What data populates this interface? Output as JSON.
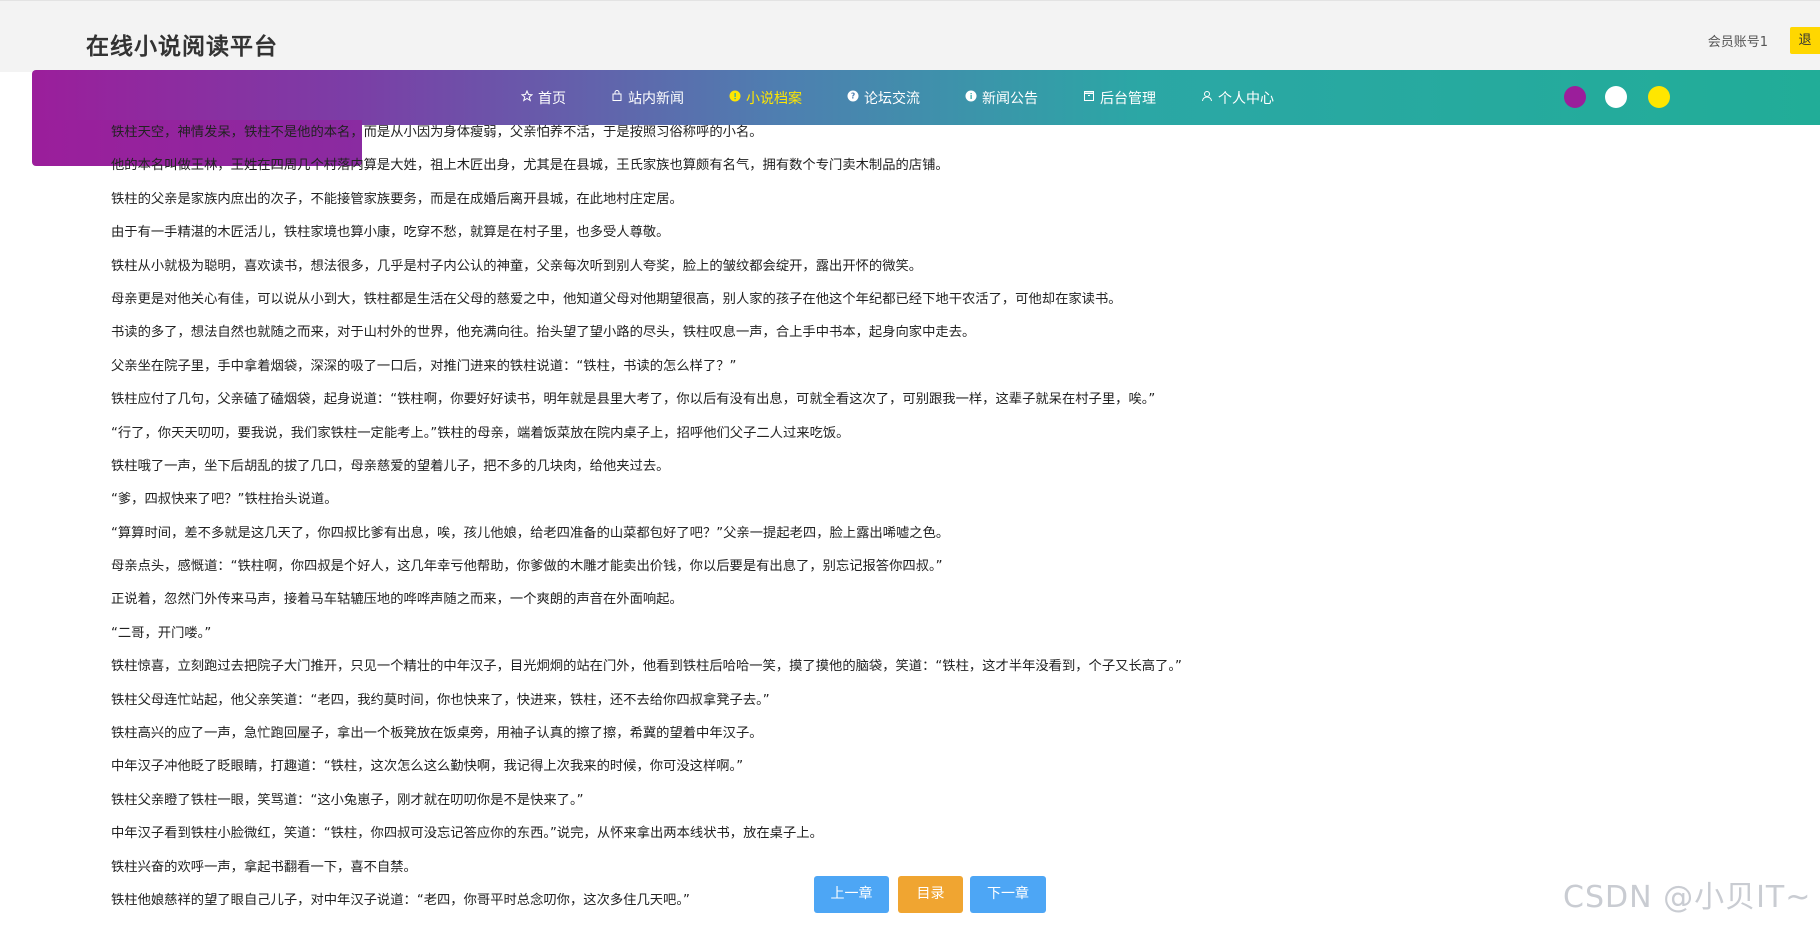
{
  "site": {
    "title": "在线小说阅读平台",
    "account_label": "会员账号1",
    "yellow_button_label": "退"
  },
  "nav": {
    "items": [
      {
        "label": "首页",
        "icon": "star-icon"
      },
      {
        "label": "站内新闻",
        "icon": "bag-icon"
      },
      {
        "label": "小说档案",
        "icon": "info-circle-icon",
        "active": true
      },
      {
        "label": "论坛交流",
        "icon": "question-circle-icon"
      },
      {
        "label": "新闻公告",
        "icon": "info-circle-icon"
      },
      {
        "label": "后台管理",
        "icon": "box-icon"
      },
      {
        "label": "个人中心",
        "icon": "user-icon"
      }
    ],
    "theme_dots": [
      "#9b1e9b",
      "#ffffff",
      "#ffe600"
    ]
  },
  "article": {
    "paragraphs": [
      "铁柱天空，神情发呆，铁柱不是他的本名，而是从小因为身体瘦弱，父亲怕养不活，于是按照习俗称呼的小名。",
      "他的本名叫做王林，王姓在四周几个村落内算是大姓，祖上木匠出身，尤其是在县城，王氏家族也算颇有名气，拥有数个专门卖木制品的店铺。",
      "铁柱的父亲是家族内庶出的次子，不能接管家族要务，而是在成婚后离开县城，在此地村庄定居。",
      "由于有一手精湛的木匠活儿，铁柱家境也算小康，吃穿不愁，就算是在村子里，也多受人尊敬。",
      "铁柱从小就极为聪明，喜欢读书，想法很多，几乎是村子内公认的神童，父亲每次听到别人夸奖，脸上的皱纹都会绽开，露出开怀的微笑。",
      "母亲更是对他关心有佳，可以说从小到大，铁柱都是生活在父母的慈爱之中，他知道父母对他期望很高，别人家的孩子在他这个年纪都已经下地干农活了，可他却在家读书。",
      "书读的多了，想法自然也就随之而来，对于山村外的世界，他充满向往。抬头望了望小路的尽头，铁柱叹息一声，合上手中书本，起身向家中走去。",
      "父亲坐在院子里，手中拿着烟袋，深深的吸了一口后，对推门进来的铁柱说道：“铁柱，书读的怎么样了？”",
      "铁柱应付了几句，父亲磕了磕烟袋，起身说道：“铁柱啊，你要好好读书，明年就是县里大考了，你以后有没有出息，可就全看这次了，可别跟我一样，这辈子就呆在村子里，唉。”",
      "“行了，你天天叨叨，要我说，我们家铁柱一定能考上。”铁柱的母亲，端着饭菜放在院内桌子上，招呼他们父子二人过来吃饭。",
      "铁柱哦了一声，坐下后胡乱的拔了几口，母亲慈爱的望着儿子，把不多的几块肉，给他夹过去。",
      "“爹，四叔快来了吧？”铁柱抬头说道。",
      "“算算时间，差不多就是这几天了，你四叔比爹有出息，唉，孩儿他娘，给老四准备的山菜都包好了吧？”父亲一提起老四，脸上露出唏嘘之色。",
      "母亲点头，感慨道：“铁柱啊，你四叔是个好人，这几年幸亏他帮助，你爹做的木雕才能卖出价钱，你以后要是有出息了，别忘记报答你四叔。”",
      "正说着，忽然门外传来马声，接着马车轱辘压地的哗哗声随之而来，一个爽朗的声音在外面响起。",
      "“二哥，开门喽。”",
      "铁柱惊喜，立刻跑过去把院子大门推开，只见一个精壮的中年汉子，目光炯炯的站在门外，他看到铁柱后哈哈一笑，摸了摸他的脑袋，笑道：“铁柱，这才半年没看到，个子又长高了。”",
      "铁柱父母连忙站起，他父亲笑道：“老四，我约莫时间，你也快来了，快进来，铁柱，还不去给你四叔拿凳子去。”",
      "铁柱高兴的应了一声，急忙跑回屋子，拿出一个板凳放在饭桌旁，用袖子认真的擦了擦，希冀的望着中年汉子。",
      "中年汉子冲他眨了眨眼睛，打趣道：“铁柱，这次怎么这么勤快啊，我记得上次我来的时候，你可没这样啊。”",
      "铁柱父亲瞪了铁柱一眼，笑骂道：“这小兔崽子，刚才就在叨叨你是不是快来了。”",
      "中年汉子看到铁柱小脸微红，笑道：“铁柱，你四叔可没忘记答应你的东西。”说完，从怀来拿出两本线状书，放在桌子上。",
      "铁柱兴奋的欢呼一声，拿起书翻看一下，喜不自禁。",
      "铁柱他娘慈祥的望了眼自己儿子，对中年汉子说道：“老四，你哥平时总念叨你，这次多住几天吧。”"
    ]
  },
  "pager": {
    "prev_label": "上一章",
    "toc_label": "目录",
    "next_label": "下一章"
  },
  "watermark": {
    "text": "CSDN @小贝IT~"
  }
}
